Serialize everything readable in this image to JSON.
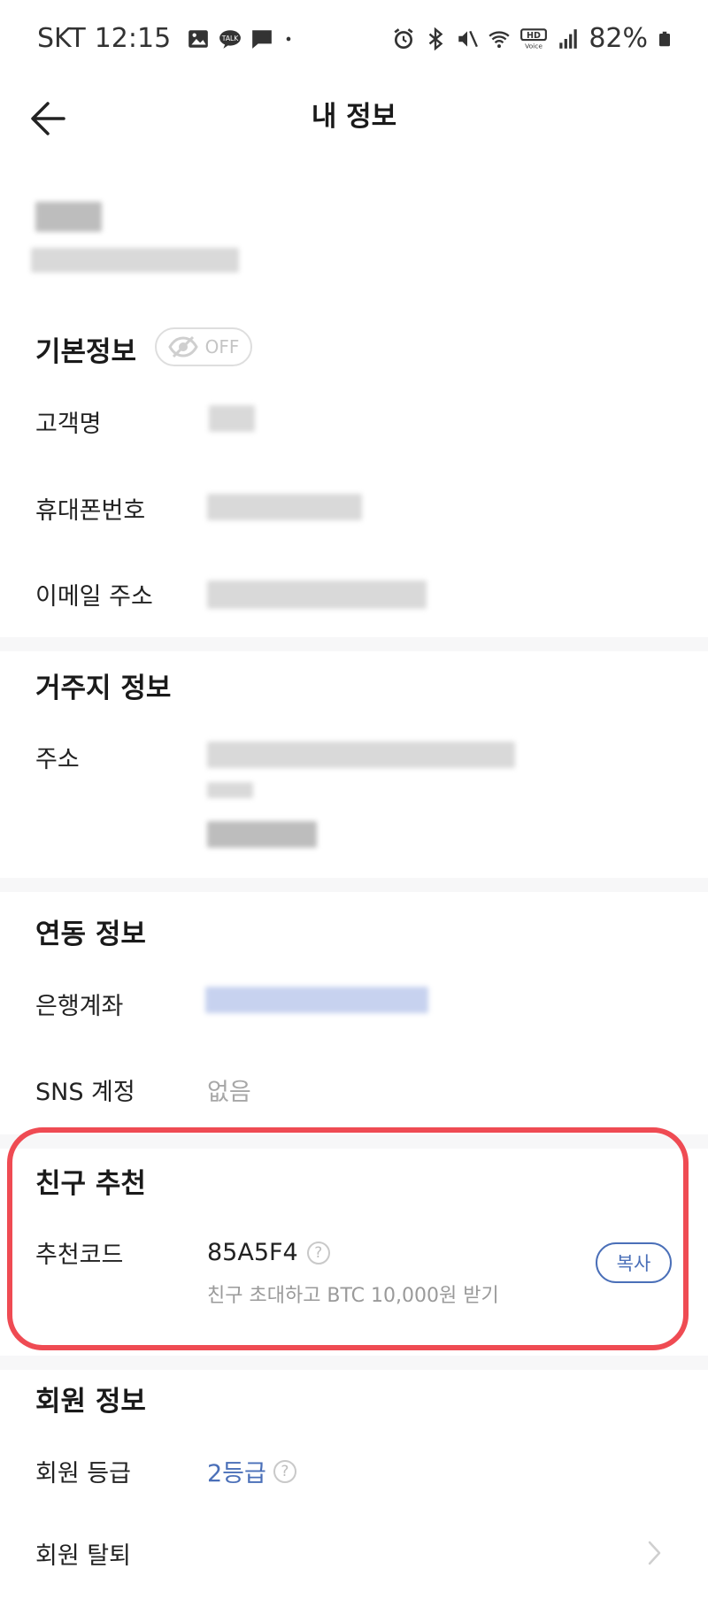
{
  "status_bar": {
    "carrier": "SKT",
    "time": "12:15",
    "battery": "82%",
    "left_icons": [
      "gallery-icon",
      "kakaotalk-icon",
      "message-icon",
      "dot-icon"
    ],
    "right_icons": [
      "alarm-icon",
      "bluetooth-icon",
      "mute-icon",
      "wifi-icon",
      "hd-voice-icon",
      "signal-icon",
      "battery-icon"
    ]
  },
  "header": {
    "title": "내 정보"
  },
  "basic_info": {
    "title": "기본정보",
    "toggle_label": "OFF",
    "rows": {
      "name_label": "고객명",
      "phone_label": "휴대폰번호",
      "email_label": "이메일 주소"
    }
  },
  "residence": {
    "title": "거주지 정보",
    "address_label": "주소"
  },
  "linked": {
    "title": "연동 정보",
    "bank_label": "은행계좌",
    "sns_label": "SNS 계정",
    "sns_value": "없음"
  },
  "referral": {
    "title": "친구 추천",
    "code_label": "추천코드",
    "code": "85A5F4",
    "help": "?",
    "description": "친구 초대하고 BTC 10,000원 받기",
    "copy_label": "복사"
  },
  "membership": {
    "title": "회원 정보",
    "grade_label": "회원 등급",
    "grade_value": "2등급",
    "help": "?",
    "withdraw_label": "회원 탈퇴"
  },
  "colors": {
    "accent": "#4a6fb8",
    "highlight": "#ef4b53",
    "muted": "#a7a7a7",
    "divider": "#f7f7f8"
  }
}
